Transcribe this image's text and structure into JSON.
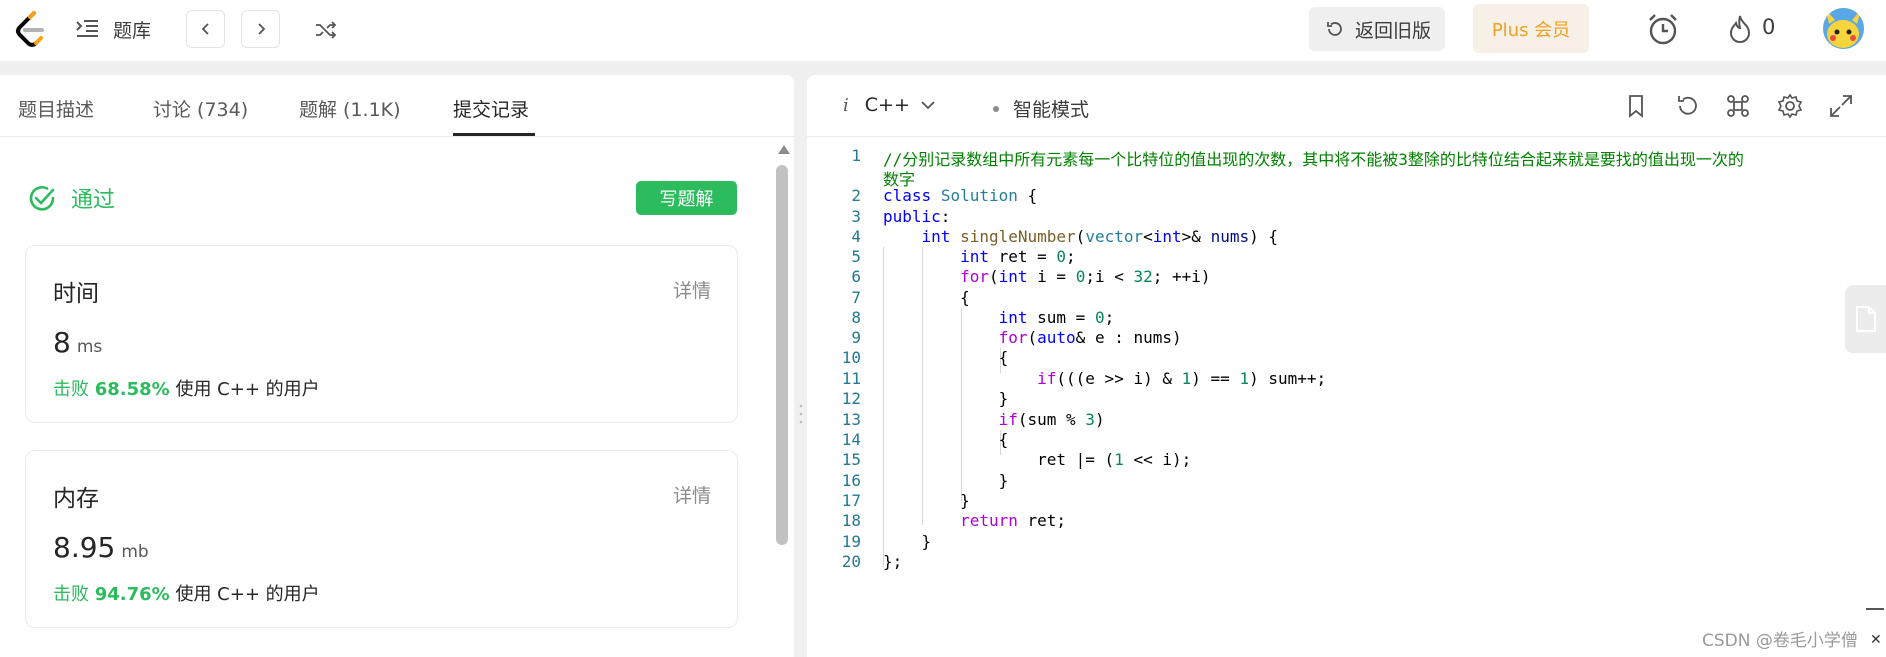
{
  "topbar": {
    "problem_bank": "题库",
    "revert_label": "返回旧版",
    "plus_label": "Plus 会员",
    "streak_count": "0"
  },
  "left": {
    "tabs": [
      {
        "label": "题目描述"
      },
      {
        "label": "讨论 (734)"
      },
      {
        "label": "题解 (1.1K)"
      },
      {
        "label": "提交记录"
      }
    ],
    "status": "通过",
    "write_solution": "写题解",
    "time_card": {
      "title": "时间",
      "detail": "详情",
      "value": "8",
      "unit": "ms",
      "beat_prefix": "击败",
      "beat_pct": "68.58%",
      "beat_suffix": "使用 C++ 的用户"
    },
    "memory_card": {
      "title": "内存",
      "detail": "详情",
      "value": "8.95",
      "unit": "mb",
      "beat_prefix": "击败",
      "beat_pct": "94.76%",
      "beat_suffix": "使用 C++ 的用户"
    }
  },
  "editor": {
    "language": "C++",
    "mode": "智能模式",
    "line_numbers": [
      "1",
      "2",
      "3",
      "4",
      "5",
      "6",
      "7",
      "8",
      "9",
      "10",
      "11",
      "12",
      "13",
      "14",
      "15",
      "16",
      "17",
      "18",
      "19",
      "20"
    ],
    "comment_line1": "//分别记录数组中所有元素每一个比特位的值出现的次数，其中将不能被3整除的比特位结合起来就是要找的值出现一次的",
    "comment_line2": "数字"
  },
  "watermark": "CSDN @卷毛小学僧",
  "colors": {
    "accent_green": "#2cbb5d",
    "plus_orange": "#f0a020",
    "line_number": "#237893"
  }
}
